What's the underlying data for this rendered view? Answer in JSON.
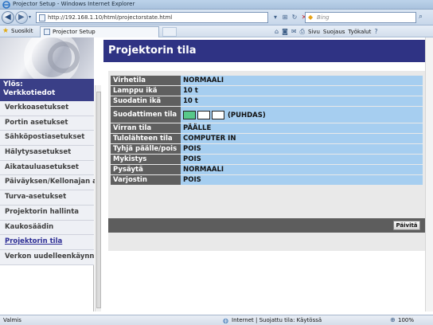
{
  "window": {
    "title": "Projector Setup - Windows Internet Explorer"
  },
  "address": {
    "url": "http://192.168.1.10/html/projectorstate.html"
  },
  "search": {
    "placeholder": "Bing"
  },
  "favorites": {
    "label": "Suosikit",
    "tab_title": "Projector Setup"
  },
  "commandbar": {
    "page": "Sivu",
    "safety": "Suojaus",
    "tools": "Työkalut"
  },
  "sidebar": {
    "up_line1": "Ylös:",
    "up_line2": "Verkkotiedot",
    "items": [
      {
        "label": "Verkkoasetukset"
      },
      {
        "label": "Portin asetukset"
      },
      {
        "label": "Sähköpostiasetukset"
      },
      {
        "label": "Hälytysasetukset"
      },
      {
        "label": "Aikatauluasetukset"
      },
      {
        "label": "Päiväyksen/Kellonajan a"
      },
      {
        "label": "Turva-asetukset"
      },
      {
        "label": "Projektorin hallinta"
      },
      {
        "label": "Kaukosäädin"
      },
      {
        "label": "Projektorin tila"
      },
      {
        "label": "Verkon uudelleenkäynni"
      }
    ],
    "active_index": 9
  },
  "main": {
    "title": "Projektorin tila",
    "rows": [
      {
        "key": "Virhetila",
        "value": "NORMAALI"
      },
      {
        "key": "Lamppu ikä",
        "value": "10 t"
      },
      {
        "key": "Suodatin ikä",
        "value": "10 t"
      },
      {
        "key": "Suodattimen tila",
        "value": "(PUHDAS)"
      },
      {
        "key": "Virran tila",
        "value": "PÄÄLLE"
      },
      {
        "key": "Tulolähteen tila",
        "value": "COMPUTER IN"
      },
      {
        "key": "Tyhjä päälle/pois",
        "value": "POIS"
      },
      {
        "key": "Mykistys",
        "value": "POIS"
      },
      {
        "key": "Pysäytä",
        "value": "NORMAALI"
      },
      {
        "key": "Varjostin",
        "value": "POIS"
      }
    ],
    "filter_level": {
      "filled": 1,
      "total": 3,
      "color": "#57c88a"
    },
    "refresh_label": "Päivitä"
  },
  "status": {
    "text": "Valmis",
    "zone": "Internet | Suojattu tila: Käytössä",
    "zoom": "100%"
  },
  "colors": {
    "title_bar": "#2f3384",
    "key_cell": "#5f5f5f",
    "value_cell": "#a6cef0"
  }
}
